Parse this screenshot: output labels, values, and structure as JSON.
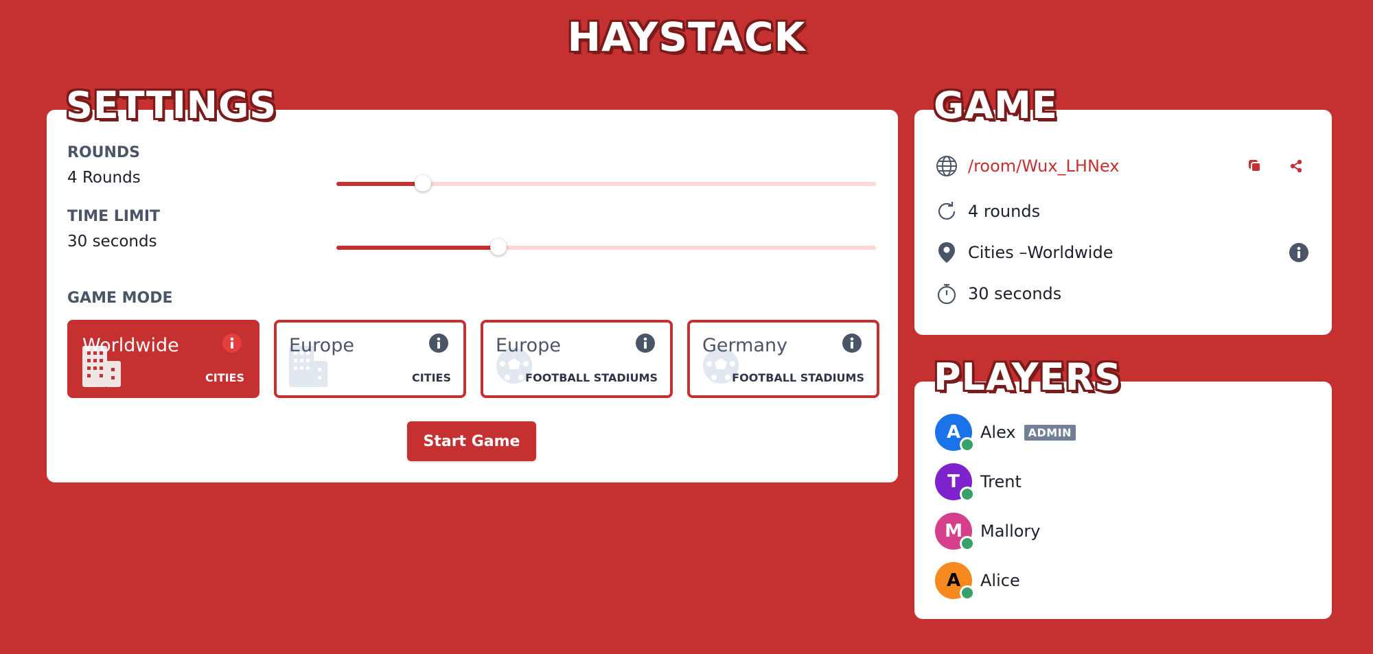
{
  "app": {
    "title": "HAYSTACK"
  },
  "settings": {
    "title": "SETTINGS",
    "rounds": {
      "label": "ROUNDS",
      "value": "4 Rounds",
      "level": 0.16
    },
    "time_limit": {
      "label": "TIME LIMIT",
      "value": "30 seconds",
      "level": 0.3
    },
    "game_mode": {
      "label": "GAME MODE",
      "modes": [
        {
          "name": "Worldwide",
          "type": "CITIES",
          "icon": "building-icon",
          "active": true
        },
        {
          "name": "Europe",
          "type": "CITIES",
          "icon": "building-icon",
          "active": false
        },
        {
          "name": "Europe",
          "type": "FOOTBALL STADIUMS",
          "icon": "soccer-ball-icon",
          "active": false
        },
        {
          "name": "Germany",
          "type": "FOOTBALL STADIUMS",
          "icon": "soccer-ball-icon",
          "active": false
        }
      ]
    },
    "start_label": "Start Game"
  },
  "game": {
    "title": "GAME",
    "room_link": "/room/Wux_LHNex",
    "rounds": "4 rounds",
    "mode": "Cities –Worldwide",
    "time": "30 seconds"
  },
  "players": {
    "title": "PLAYERS",
    "list": [
      {
        "initial": "A",
        "name": "Alex",
        "badge": "ADMIN",
        "color": "#1a73e8",
        "initial_color": "#ffffff"
      },
      {
        "initial": "T",
        "name": "Trent",
        "color": "#7e22ce",
        "initial_color": "#ffffff"
      },
      {
        "initial": "M",
        "name": "Mallory",
        "color": "#d53f8c",
        "initial_color": "#ffffff"
      },
      {
        "initial": "A",
        "name": "Alice",
        "color": "#f6891f",
        "initial_color": "#000000"
      }
    ]
  },
  "colors": {
    "background": "#c53030",
    "accent": "#c53030",
    "online": "#38a169"
  }
}
